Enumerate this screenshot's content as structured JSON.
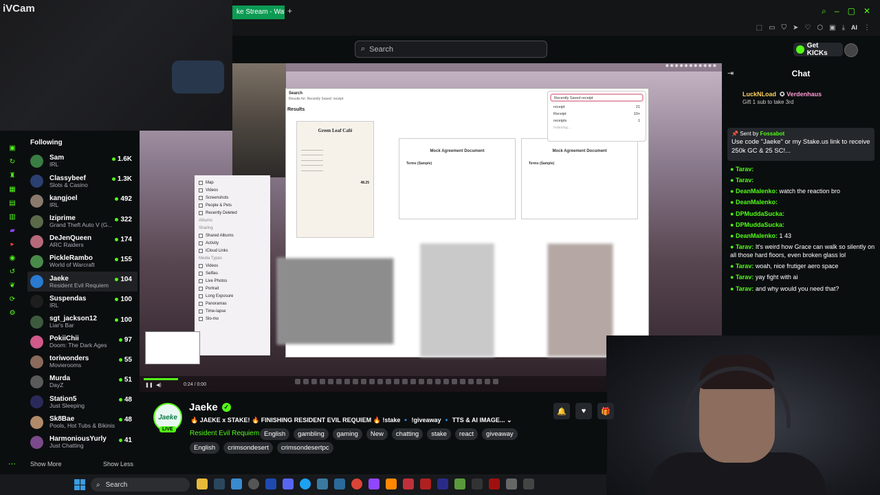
{
  "ivcam": {
    "logo": "iVCam"
  },
  "browser": {
    "tab_title": "ke Stream - Watch",
    "new_tab": "+",
    "toolbar_ai": "AI"
  },
  "header": {
    "search_placeholder": "Search",
    "get_kicks": "Get KICKs"
  },
  "sidebar": {
    "title": "Following",
    "show_more": "Show More",
    "show_less": "Show Less",
    "items": [
      {
        "name": "Sam",
        "category": "IRL",
        "viewers": "1.6K",
        "color": "#3a7d44"
      },
      {
        "name": "Classybeef",
        "category": "Slots & Casino",
        "viewers": "1.3K",
        "color": "#2b3f70"
      },
      {
        "name": "kangjoel",
        "category": "IRL",
        "viewers": "492",
        "color": "#8a7a6d"
      },
      {
        "name": "Iziprime",
        "category": "Grand Theft Auto V (G...",
        "viewers": "322",
        "color": "#5a6a4a"
      },
      {
        "name": "DeJenQueen",
        "category": "ARC Raiders",
        "viewers": "174",
        "color": "#b76a7a"
      },
      {
        "name": "PickleRambo",
        "category": "World of Warcraft",
        "viewers": "155",
        "color": "#4a8a4a"
      },
      {
        "name": "Jaeke",
        "category": "Resident Evil Requiem",
        "viewers": "104",
        "color": "#2a7ad0"
      },
      {
        "name": "Suspendas",
        "category": "IRL",
        "viewers": "100",
        "color": "#1e1e1e"
      },
      {
        "name": "sgt_jackson12",
        "category": "Liar's Bar",
        "viewers": "100",
        "color": "#3e5a3e"
      },
      {
        "name": "PokiiChii",
        "category": "Doom: The Dark Ages",
        "viewers": "97",
        "color": "#d05a8a"
      },
      {
        "name": "toriwonders",
        "category": "Movierooms",
        "viewers": "55",
        "color": "#8a6a5a"
      },
      {
        "name": "Murda",
        "category": "DayZ",
        "viewers": "51",
        "color": "#5a5a5a"
      },
      {
        "name": "Station5",
        "category": "Just Sleeping",
        "viewers": "48",
        "color": "#2a2a5a"
      },
      {
        "name": "Sk8Bae",
        "category": "Pools, Hot Tubs & Bikinis",
        "viewers": "48",
        "color": "#b08a6a"
      },
      {
        "name": "HarmoniousYurly",
        "category": "Just Chatting",
        "viewers": "41",
        "color": "#7a4a8a"
      }
    ]
  },
  "video": {
    "search_panel_title": "Search",
    "search_panel_sub": "Results for: Recently Saved: receipt",
    "results_label": "Results",
    "search_query": "Recently Saved  receipt",
    "suggestions": [
      {
        "label": "receipt",
        "count": "21"
      },
      {
        "label": "Receipt",
        "count": "10+"
      },
      {
        "label": "receipts",
        "count": "1"
      }
    ],
    "indexing": "Indexing...",
    "receipt_title": "Green Leaf Café",
    "receipt_total": "48.25",
    "doc_title": "Mock Agreement Document",
    "doc_terms": "Terms (Sample)",
    "finder_items": [
      "Map",
      "Videos",
      "Screenshots",
      "People & Pets",
      "Recently Deleted"
    ],
    "finder_albums": "Albums",
    "finder_sharing": "Sharing",
    "finder_sharing_items": [
      "Shared Albums",
      "Activity",
      "iCloud Links"
    ],
    "finder_media": "Media Types",
    "finder_media_items": [
      "Videos",
      "Selfies",
      "Live Photos",
      "Portrait",
      "Long Exposure",
      "Panoramas",
      "Time-lapse",
      "Slo-mo"
    ],
    "player_time": "0:24 / 0:00"
  },
  "chat": {
    "title": "Chat",
    "gift_user1": "LuckNLoad",
    "gift_user2": "Verdenhaus",
    "gift_text": "Gift 1 sub to take 3rd",
    "pinned_by_label": "Sent by",
    "pinned_by": "Fossabot",
    "pinned_text": "Use code \"Jaeke\" or my Stake.us link to receive 250k GC & 25 SC!...",
    "messages": [
      {
        "user": "Tarav:",
        "text": "",
        "color": "#53fc18"
      },
      {
        "user": "Tarav:",
        "text": "",
        "color": "#53fc18"
      },
      {
        "user": "DeanMalenko:",
        "text": "watch the reaction bro",
        "color": "#53fc18"
      },
      {
        "user": "DeanMalenko:",
        "text": "",
        "color": "#53fc18"
      },
      {
        "user": "DPMuddaSucka:",
        "text": "",
        "color": "#53fc18"
      },
      {
        "user": "DPMuddaSucka:",
        "text": "",
        "color": "#53fc18"
      },
      {
        "user": "DeanMalenko:",
        "text": "1 43",
        "color": "#53fc18"
      },
      {
        "user": "Tarav:",
        "text": "It's weird how Grace can walk so silently on all those hard floors, even broken glass lol",
        "color": "#53fc18"
      },
      {
        "user": "Tarav:",
        "text": "woah, nice frutiger aero space",
        "color": "#53fc18"
      },
      {
        "user": "Tarav:",
        "text": "yay fight with ai",
        "color": "#53fc18"
      },
      {
        "user": "Tarav:",
        "text": "and why would you need that?",
        "color": "#53fc18"
      }
    ]
  },
  "stream": {
    "streamer": "Jaeke",
    "live": "LIVE",
    "title": "🔥 JAEKE x STAKE! 🔥 FINISHING RESIDENT EVIL REQUIEM 🔥 !stake 🔹 !giveaway 🔹 TTS & AI IMAGE...",
    "category": "Resident Evil Requiem",
    "tags_row1": [
      "English",
      "gambling",
      "gaming",
      "New",
      "chatting",
      "stake",
      "react",
      "giveaway"
    ],
    "tags_row2": [
      "English",
      "crimsondesert",
      "crimsondesertpc"
    ]
  },
  "taskbar": {
    "search": "Search"
  },
  "colors": {
    "accent": "#53fc18",
    "bg": "#0b0e0f"
  }
}
